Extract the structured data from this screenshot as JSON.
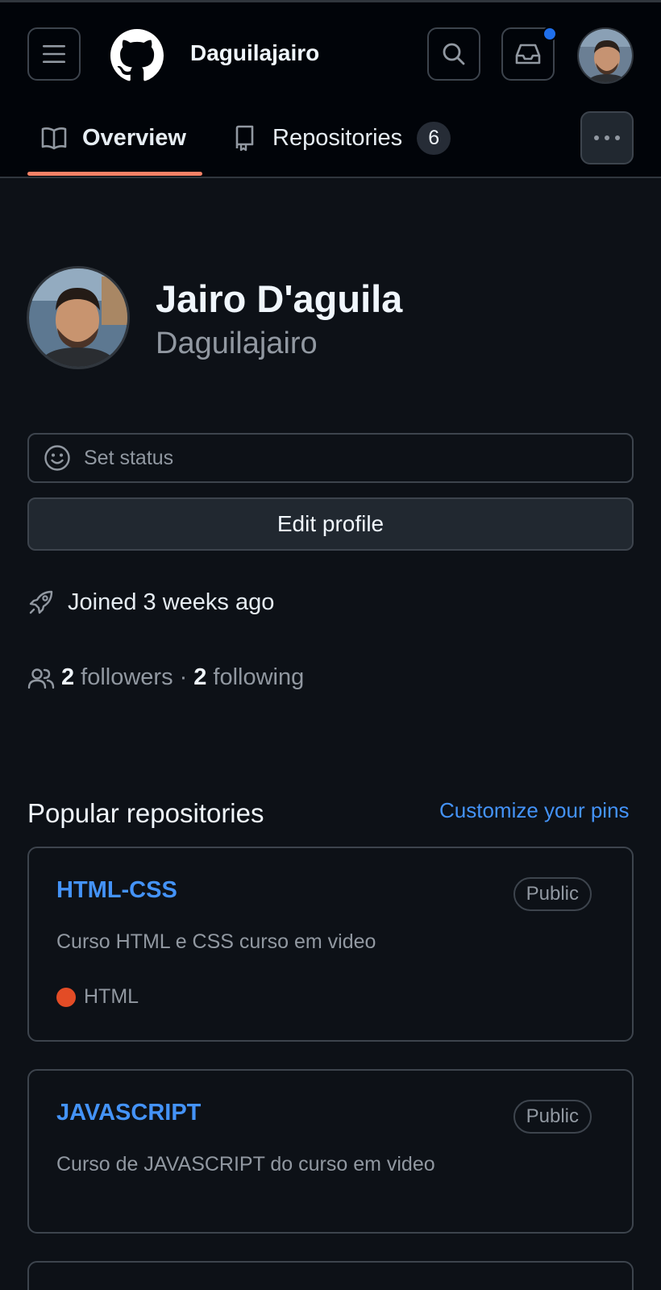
{
  "header": {
    "username": "Daguilajairo",
    "has_notification": true,
    "notification_color": "#1f6feb"
  },
  "tabs": [
    {
      "label": "Overview",
      "icon": "book-icon",
      "selected": true
    },
    {
      "label": "Repositories",
      "icon": "repo-icon",
      "count": "6",
      "selected": false
    }
  ],
  "profile": {
    "full_name": "Jairo D'aguila",
    "login": "Daguilajairo",
    "set_status_label": "Set status",
    "edit_profile_label": "Edit profile",
    "joined_text": "Joined 3 weeks ago",
    "followers_count": "2",
    "followers_label": "followers",
    "separator": "·",
    "following_count": "2",
    "following_label": "following"
  },
  "popular": {
    "title": "Popular repositories",
    "customize_label": "Customize your pins",
    "repos": [
      {
        "name": "HTML-CSS",
        "visibility": "Public",
        "description": "Curso HTML e CSS curso em video",
        "language": "HTML",
        "language_color": "#e34c26"
      },
      {
        "name": "JAVASCRIPT",
        "visibility": "Public",
        "description": "Curso de JAVASCRIPT do curso em video"
      }
    ]
  },
  "colors": {
    "accent_link": "#4493f8",
    "tab_underline": "#f78166",
    "background": "#0d1117"
  }
}
